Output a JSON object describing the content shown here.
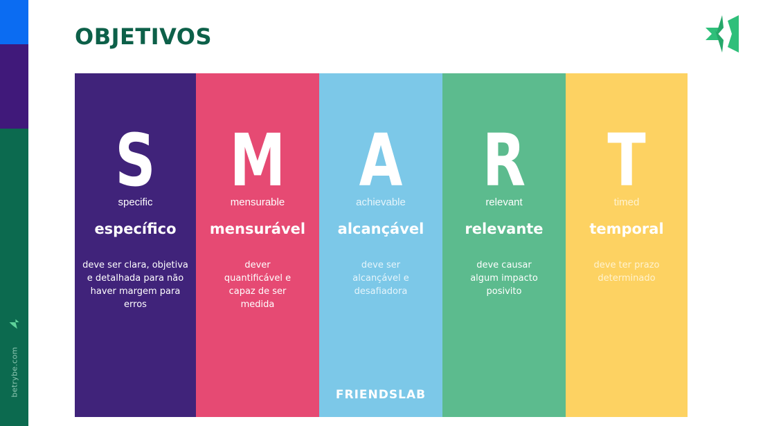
{
  "page": {
    "title": "OBJETIVOS",
    "site": "betrybe.com",
    "colors": {
      "title": "#0d6049",
      "stripe_blue": "#0b6cf2",
      "stripe_purple": "#40197a",
      "stripe_green": "#0c6a4f",
      "logo_green": "#2fbf7a"
    }
  },
  "smart": {
    "columns": [
      {
        "letter": "S",
        "english": "specific",
        "portuguese": "específico",
        "description": "deve ser clara, objetiva e detalhada para não haver margem para erros",
        "color": "#40237a"
      },
      {
        "letter": "M",
        "english": "mensurable",
        "portuguese": "mensurável",
        "description": "dever quantificável e capaz de ser medida",
        "color": "#e64a73"
      },
      {
        "letter": "A",
        "english": "achievable",
        "portuguese": "alcançável",
        "description": "deve ser alcançável e desafiadora",
        "color": "#7cc8e8"
      },
      {
        "letter": "R",
        "english": "relevant",
        "portuguese": "relevante",
        "description": "deve causar algum impacto posivito",
        "color": "#5cbb8e"
      },
      {
        "letter": "T",
        "english": "timed",
        "portuguese": "temporal",
        "description": "deve ter prazo determinado",
        "color": "#fdd262"
      }
    ],
    "footer_brand": "FRIENDSLAB"
  }
}
